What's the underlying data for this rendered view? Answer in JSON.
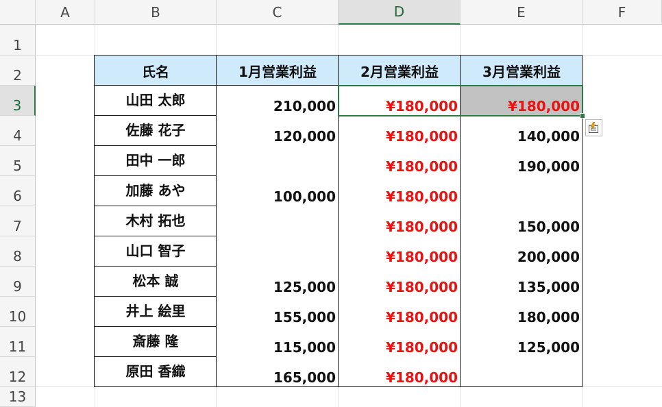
{
  "columns": [
    "A",
    "B",
    "C",
    "D",
    "E",
    "F"
  ],
  "rows": [
    "1",
    "2",
    "3",
    "4",
    "5",
    "6",
    "7",
    "8",
    "9",
    "10",
    "11",
    "12",
    "13"
  ],
  "selected_column": "D",
  "selected_row": "3",
  "table": {
    "headers": [
      "氏名",
      "1月営業利益",
      "2月営業利益",
      "3月営業利益"
    ],
    "records": [
      {
        "name": "山田 太郎",
        "jan": "210,000",
        "feb": "¥180,000",
        "mar": "¥180,000"
      },
      {
        "name": "佐藤 花子",
        "jan": "120,000",
        "feb": "¥180,000",
        "mar": "140,000"
      },
      {
        "name": "田中 一郎",
        "jan": "",
        "feb": "¥180,000",
        "mar": "190,000"
      },
      {
        "name": "加藤 あや",
        "jan": "100,000",
        "feb": "¥180,000",
        "mar": ""
      },
      {
        "name": "木村 拓也",
        "jan": "",
        "feb": "¥180,000",
        "mar": "150,000"
      },
      {
        "name": "山口 智子",
        "jan": "",
        "feb": "¥180,000",
        "mar": "200,000"
      },
      {
        "name": "松本 誠",
        "jan": "125,000",
        "feb": "¥180,000",
        "mar": "135,000"
      },
      {
        "name": "井上 絵里",
        "jan": "155,000",
        "feb": "¥180,000",
        "mar": "180,000"
      },
      {
        "name": "斎藤 隆",
        "jan": "115,000",
        "feb": "¥180,000",
        "mar": "125,000"
      },
      {
        "name": "原田 香織",
        "jan": "165,000",
        "feb": "¥180,000",
        "mar": ""
      }
    ]
  },
  "colors": {
    "header_fill": "#cfeafa",
    "red_text": "#ee1111",
    "selected_fill": "#c2c2c2",
    "selection_border": "#2a7a45"
  },
  "icons": {
    "quick_analysis": "quick-analysis-icon"
  }
}
